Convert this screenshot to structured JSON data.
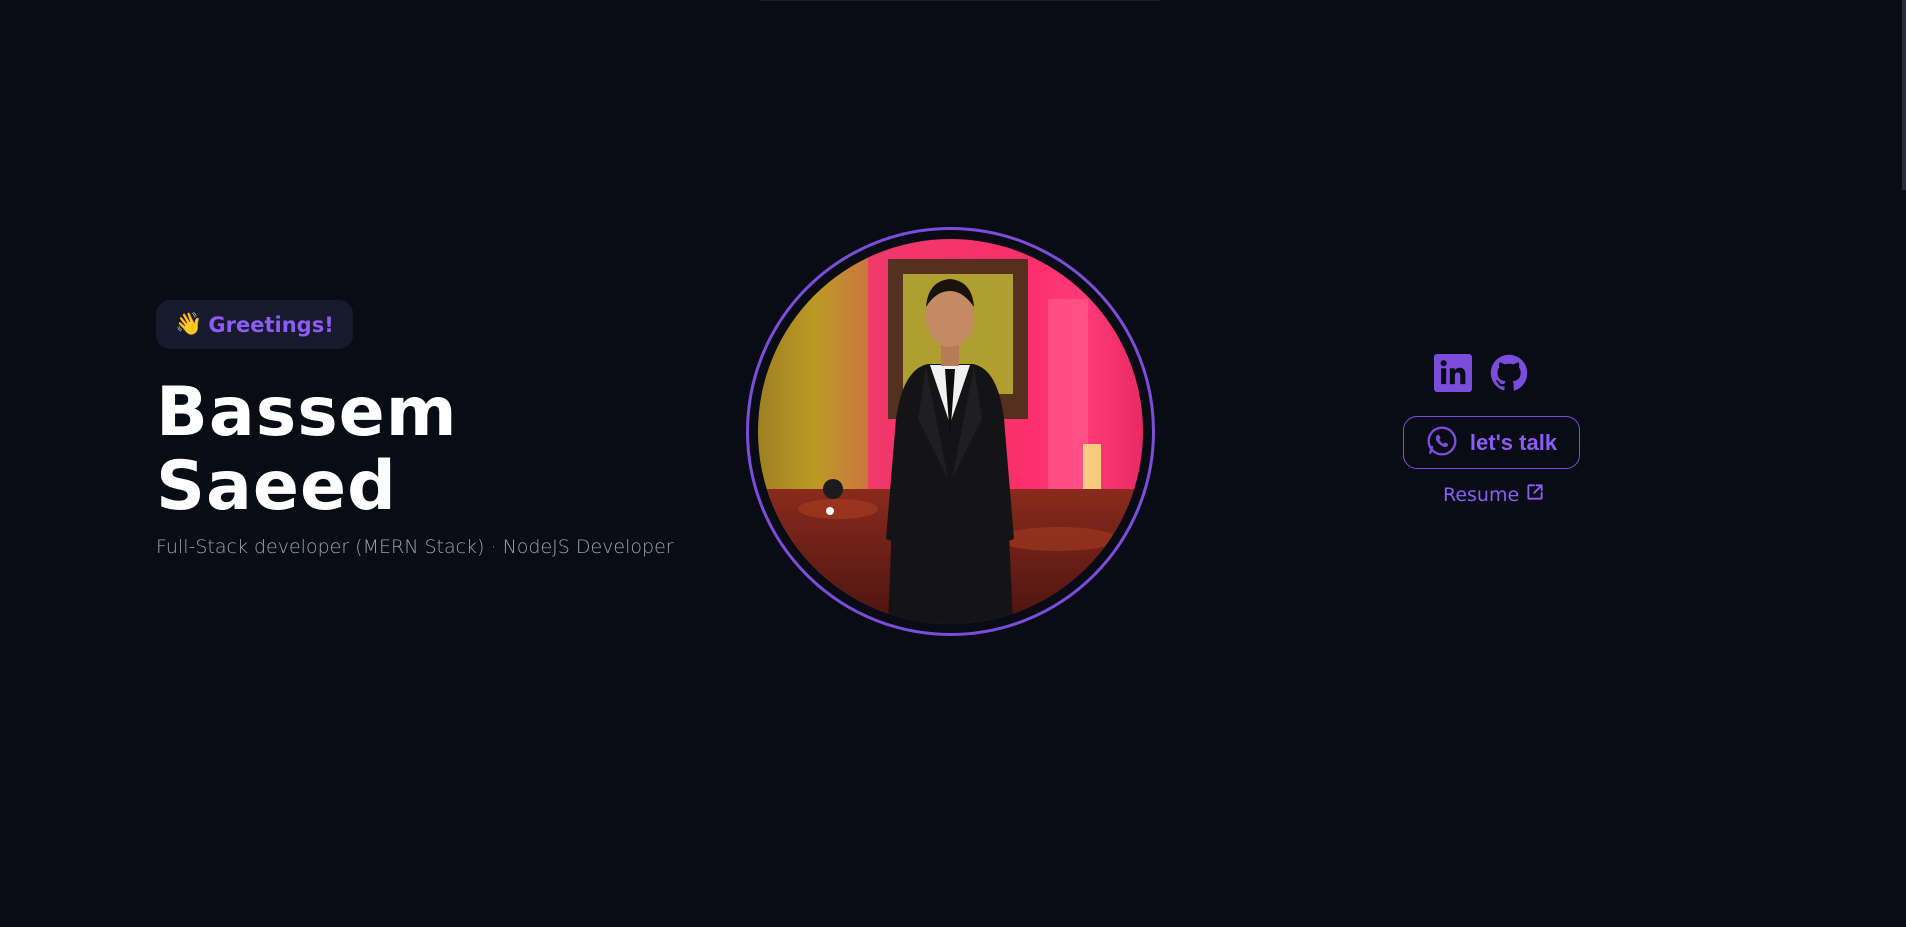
{
  "hero": {
    "greeting_emoji": "👋",
    "greeting": "Greetings!",
    "first_name": "Bassem",
    "last_name": "Saeed",
    "subtitle": "Full-Stack developer (MERN Stack) · NodeJS Developer"
  },
  "portrait": {
    "icon": "profile-photo",
    "ring_color": "#7c4ddb"
  },
  "socials": {
    "items": [
      {
        "icon": "linkedin-icon"
      },
      {
        "icon": "github-icon"
      }
    ]
  },
  "cta": {
    "talk_label": "let's talk",
    "talk_icon": "whatsapp-icon",
    "resume_label": "Resume",
    "resume_icon": "external-link-icon"
  },
  "colors": {
    "background": "#090c14",
    "accent": "#8b5cf6",
    "badge_bg": "#171a2c",
    "text_primary": "#ffffff",
    "text_muted": "#9ca3af"
  }
}
